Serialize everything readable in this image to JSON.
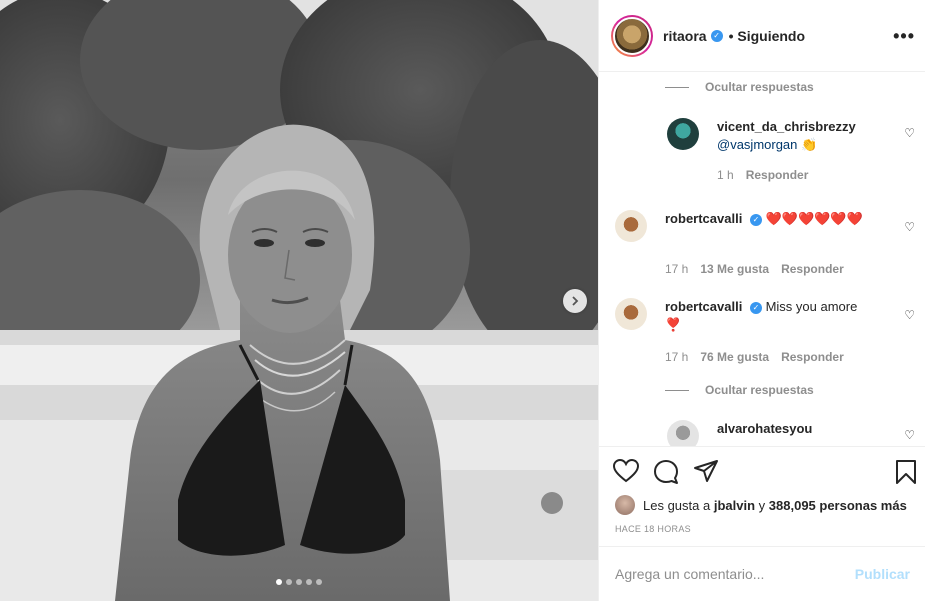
{
  "post": {
    "carousel": {
      "slide_count": 5,
      "active_index": 0
    },
    "header": {
      "username": "ritaora",
      "verified_mark": "✓",
      "follow_status": "• Siguiendo",
      "more_label": "•••"
    }
  },
  "comments": [
    {
      "type": "hide_replies",
      "label": "Ocultar respuestas"
    },
    {
      "type": "reply",
      "username": "vicent_da_chrisbrezzy",
      "mention": "@vasjmorgan",
      "emoji": "👏",
      "time": "1 h",
      "reply_label": "Responder"
    },
    {
      "type": "comment",
      "username": "robertcavalli",
      "verified_mark": "✓",
      "text": "❤️❤️❤️❤️❤️❤️",
      "time": "17 h",
      "likes": "13 Me gusta",
      "reply_label": "Responder"
    },
    {
      "type": "comment",
      "username": "robertcavalli",
      "verified_mark": "✓",
      "text": "Miss you amore",
      "emoji": "❣️",
      "time": "17 h",
      "likes": "76 Me gusta",
      "reply_label": "Responder"
    },
    {
      "type": "hide_replies",
      "label": "Ocultar respuestas"
    },
    {
      "type": "reply",
      "username": "alvarohatesyou"
    }
  ],
  "actions": {
    "likes_prefix": "Les gusta a",
    "liked_by": "jbalvin",
    "likes_connector": "y",
    "likes_count": "388,095 personas más",
    "timestamp": "HACE 18 HORAS"
  },
  "add_comment": {
    "placeholder": "Agrega un comentario...",
    "publish_label": "Publicar"
  },
  "colors": {
    "verified": "#3897f0",
    "heart_red": "#ed4956",
    "publish_disabled": "#b2dffc",
    "secondary_text": "#8e8e8e"
  },
  "icons": [
    "heart-icon",
    "comment-icon",
    "share-icon",
    "bookmark-icon",
    "chevron-right-icon",
    "more-icon"
  ]
}
